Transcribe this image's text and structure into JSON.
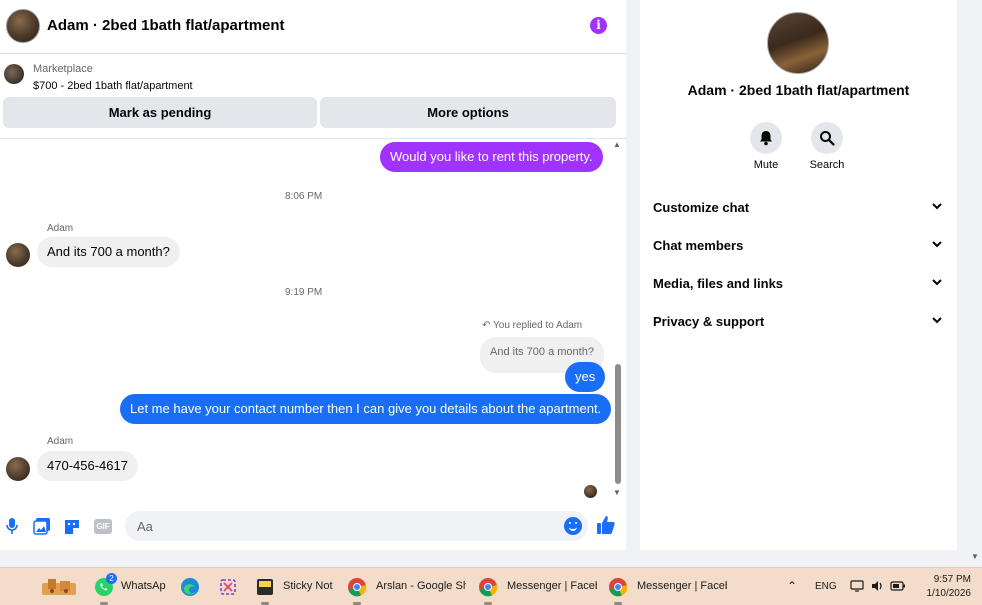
{
  "chat": {
    "header_title": "Adam · 2bed 1bath flat/apartment",
    "marketplace_label": "Marketplace",
    "listing_price_title": "$700 - 2bed 1bath flat/apartment",
    "mark_pending_label": "Mark as pending",
    "more_options_label": "More options"
  },
  "messages": {
    "m1_text": "Would you like to rent this property.",
    "t1": "8:06 PM",
    "m2_sender": "Adam",
    "m2_text": "And its 700 a month?",
    "t2": "9:19 PM",
    "reply_note": "You replied to Adam",
    "reply_quote": "And its 700 a month?",
    "m3_text": "yes",
    "m4_text": "Let me have your contact number then I can give you details about the apartment.",
    "m5_sender": "Adam",
    "m5_text": "470-456-4617"
  },
  "composer": {
    "placeholder": "Aa",
    "gif_label": "GIF"
  },
  "info_panel": {
    "name": "Adam · 2bed 1bath flat/apartment",
    "mute_label": "Mute",
    "search_label": "Search",
    "sections": [
      "Customize chat",
      "Chat members",
      "Media, files and links",
      "Privacy & support"
    ]
  },
  "taskbar": {
    "whatsapp_label": "WhatsAp",
    "whatsapp_badge": "2",
    "sticky_label": "Sticky Note",
    "chrome1_label": "Arslan - Google Sh",
    "messenger1_label": "Messenger | Faceb",
    "messenger2_label": "Messenger | Faceb",
    "language": "ENG",
    "time": "9:57 PM",
    "date": "1/10/2026"
  },
  "colors": {
    "accent_purple": "#a033ff",
    "outgoing_blue": "#1a6ef5",
    "incoming_grey": "#f0f0f0",
    "taskbar_bg": "#f3dcc9"
  }
}
